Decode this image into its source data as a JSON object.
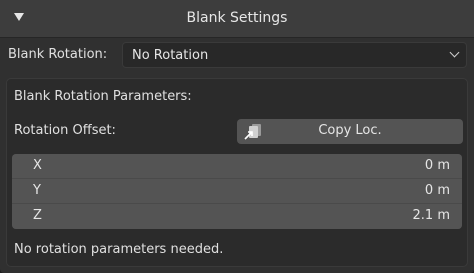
{
  "panel": {
    "title": "Blank Settings"
  },
  "rotation": {
    "label": "Blank Rotation:",
    "value": "No Rotation"
  },
  "parameters": {
    "heading": "Blank Rotation Parameters:",
    "offset_label": "Rotation Offset:",
    "copy_button_label": "Copy Loc.",
    "vector": [
      {
        "axis": "X",
        "value": "0 m"
      },
      {
        "axis": "Y",
        "value": "0 m"
      },
      {
        "axis": "Z",
        "value": "2.1 m"
      }
    ],
    "message": "No rotation parameters needed."
  },
  "icons": {
    "collapse": "triangle-down-icon",
    "dropdown": "chevron-down-icon",
    "copy": "copy-location-icon"
  },
  "colors": {
    "panel_bg": "#303030",
    "header_bg": "#3d3d3d",
    "field_bg": "#545454",
    "dropdown_bg": "#282828"
  }
}
